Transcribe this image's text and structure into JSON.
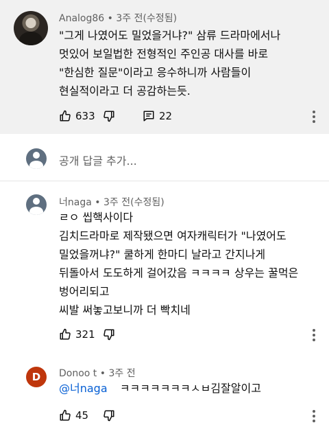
{
  "comments": [
    {
      "author": "Analog86",
      "separator": "•",
      "time": "3주 전",
      "edited": "(수정됨)",
      "lines": [
        "\"그게 나였어도 밀었을거냐?\" 삼류 드라마에서나",
        "멋있어 보일법한 전형적인 주인공 대사를 바로",
        "\"한심한 질문\"이라고 응수하니까 사람들이",
        "현실적이라고 더 공감하는듯."
      ],
      "likes": "633",
      "replies": "22",
      "avatar_icon": "profile-photo"
    },
    {
      "author": "너naga",
      "separator": "•",
      "time": "3주 전",
      "edited": "(수정됨)",
      "lines": [
        "ㄹㅇ 씹핵사이다",
        "김치드라마로 제작됐으면 여자캐릭터가 \"나였어도",
        "밀었을꺼냐?\" 쿨하게 한마디 날라고 간지나게",
        "뒤돌아서 도도하게 걸어갔음 ㅋㅋㅋㅋ 상우는 꿀먹은",
        "벙어리되고",
        "씨발 써놓고보니까 더 빡치네"
      ],
      "likes": "321",
      "avatar_icon": "default-avatar-icon"
    },
    {
      "author": "Donoo t",
      "separator": "•",
      "time": "3주 전",
      "avatar_letter": "D",
      "mention": "@너naga",
      "text": "ㅋㅋㅋㅋㅋㅋㅋㅅㅂ김잘알이고",
      "likes": "45"
    }
  ],
  "reply_box": {
    "placeholder": "공개 답글 추가..."
  },
  "colors": {
    "highlight_bg": "#f1f1f1",
    "mention": "#065fd4",
    "letter_avatar": "#bf360c"
  }
}
